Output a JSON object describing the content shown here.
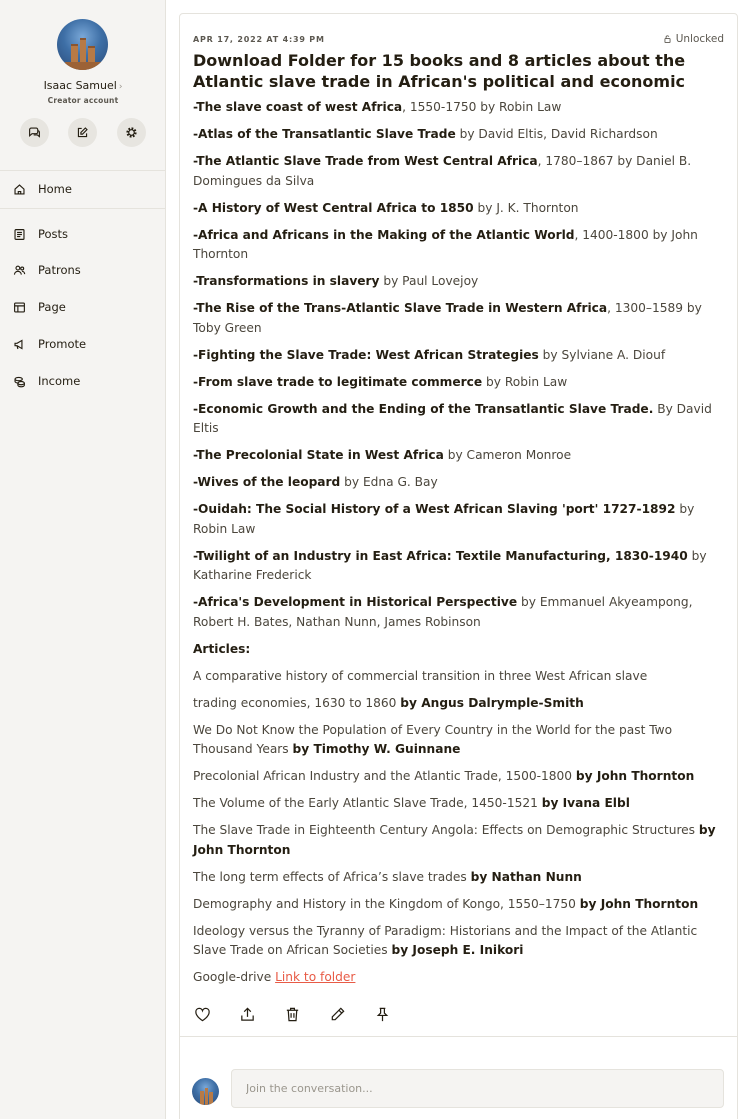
{
  "profile": {
    "name": "Isaac Samuel",
    "chevron": "›",
    "subtitle": "Creator account"
  },
  "quick_actions": [
    {
      "icon": "chat-bubbles-icon"
    },
    {
      "icon": "edit-icon"
    },
    {
      "icon": "gear-icon"
    }
  ],
  "nav": {
    "home": "Home",
    "posts": "Posts",
    "patrons": "Patrons",
    "page": "Page",
    "promote": "Promote",
    "income": "Income"
  },
  "post": {
    "date": "APR 17, 2022 AT 4:39 PM",
    "status": "Unlocked",
    "title": "Download Folder for 15 books and 8 articles about the Atlantic slave trade in African's political and economic",
    "books": [
      {
        "title": "-The slave coast of west Africa",
        "rest": ", 1550-1750 by Robin Law"
      },
      {
        "title": "-Atlas of the Transatlantic Slave Trade",
        "rest": " by David Eltis, David Richardson"
      },
      {
        "title": "-The Atlantic Slave Trade from West Central Africa",
        "rest": ", 1780–1867 by Daniel B. Domingues da Silva"
      },
      {
        "title": "-A History of West Central Africa to 1850",
        "rest": " by J. K. Thornton"
      },
      {
        "title": "-Africa and Africans in the Making of the Atlantic World",
        "rest": ", 1400-1800 by John Thornton"
      },
      {
        "title": "-Transformations in slavery",
        "rest": " by Paul Lovejoy"
      },
      {
        "title": "-The Rise of the Trans-Atlantic Slave Trade in Western Africa",
        "rest": ", 1300–1589 by Toby Green"
      },
      {
        "title": "-Fighting the Slave Trade: West African Strategies",
        "rest": " by Sylviane A. Diouf"
      },
      {
        "title": "-From slave trade to legitimate commerce",
        "rest": " by Robin Law"
      },
      {
        "title": "-Economic Growth and the Ending of the Transatlantic Slave Trade.",
        "rest": " By David Eltis"
      },
      {
        "title": "-The Precolonial State in West Africa",
        "rest": " by Cameron Monroe"
      },
      {
        "title": "-Wives of the leopard",
        "rest": " by Edna G. Bay"
      },
      {
        "title": "-Ouidah: The Social History of a West African Slaving 'port' 1727-1892",
        "rest": " by Robin Law"
      },
      {
        "title": "-Twilight of an Industry in East Africa: Textile Manufacturing, 1830-1940",
        "rest": " by Katharine Frederick"
      },
      {
        "title": "-Africa's Development in Historical Perspective",
        "rest": " by Emmanuel Akyeampong, Robert H. Bates, Nathan Nunn, James Robinson"
      }
    ],
    "articles_heading": "Articles:",
    "articles": [
      {
        "text": "A comparative history of commercial transition in three West African slave",
        "author": ""
      },
      {
        "text": "trading economies, 1630 to 1860 ",
        "author": "by Angus Dalrymple-Smith"
      },
      {
        "text": "We Do Not Know the Population of Every Country in the World for the past Two Thousand Years ",
        "author": "by Timothy W. Guinnane"
      },
      {
        "text": "Precolonial African Industry and the Atlantic Trade, 1500-1800 ",
        "author": "by John Thornton"
      },
      {
        "text": "The Volume of the Early Atlantic Slave Trade, 1450-1521 ",
        "author": "by Ivana Elbl"
      },
      {
        "text": "The Slave Trade in Eighteenth Century Angola: Effects on Demographic Structures ",
        "author": "by John Thornton"
      },
      {
        "text": "The long term effects of Africa’s slave trades ",
        "author": "by Nathan Nunn"
      },
      {
        "text": "Demography and History in the Kingdom of Kongo, 1550–1750 ",
        "author": "by John Thornton"
      },
      {
        "text": "Ideology versus the Tyranny of Paradigm: Historians and the Impact of the Atlantic Slave Trade on African Societies ",
        "author": "by Joseph E. Inikori"
      }
    ],
    "drive_label": "Google-drive ",
    "drive_link": "Link to folder"
  },
  "post_actions": [
    "heart-icon",
    "share-icon",
    "delete-icon",
    "edit-icon",
    "pin-icon"
  ],
  "comment": {
    "placeholder": "Join the conversation..."
  },
  "colors": {
    "link": "#e85b46",
    "sidebar_bg": "#f5f4f2",
    "text": "#241e12"
  }
}
